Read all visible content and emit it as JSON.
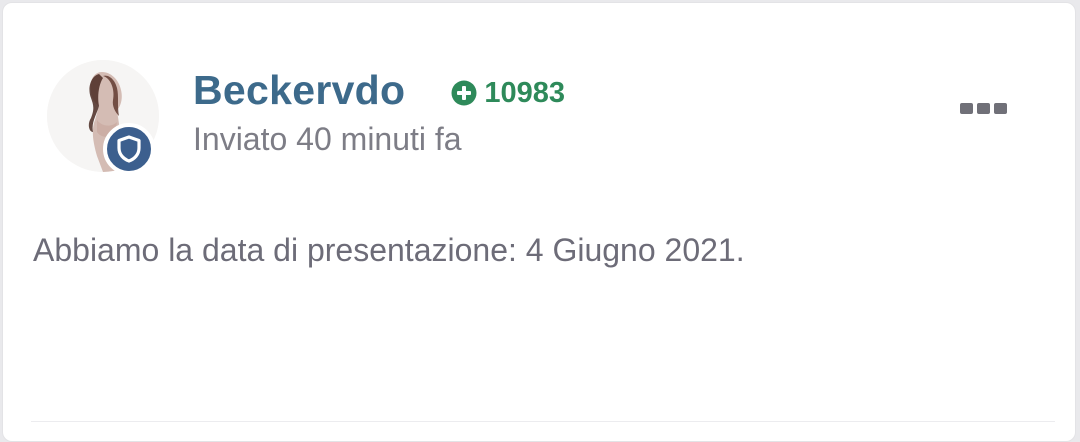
{
  "post": {
    "author": "Beckervdo",
    "reputation": "10983",
    "timestamp": "Inviato 40 minuti fa",
    "content": "Abbiamo la data di presentazione: 4 Giugno 2021."
  },
  "icons": {
    "reputation": "plus-circle-icon",
    "badge": "shield-icon",
    "menu": "more-horizontal-icon"
  },
  "colors": {
    "author": "#3d6a8b",
    "reputation": "#2e8a5a",
    "badge": "#3c5f8e",
    "text": "#6d6c78",
    "muted": "#7d7d86"
  }
}
